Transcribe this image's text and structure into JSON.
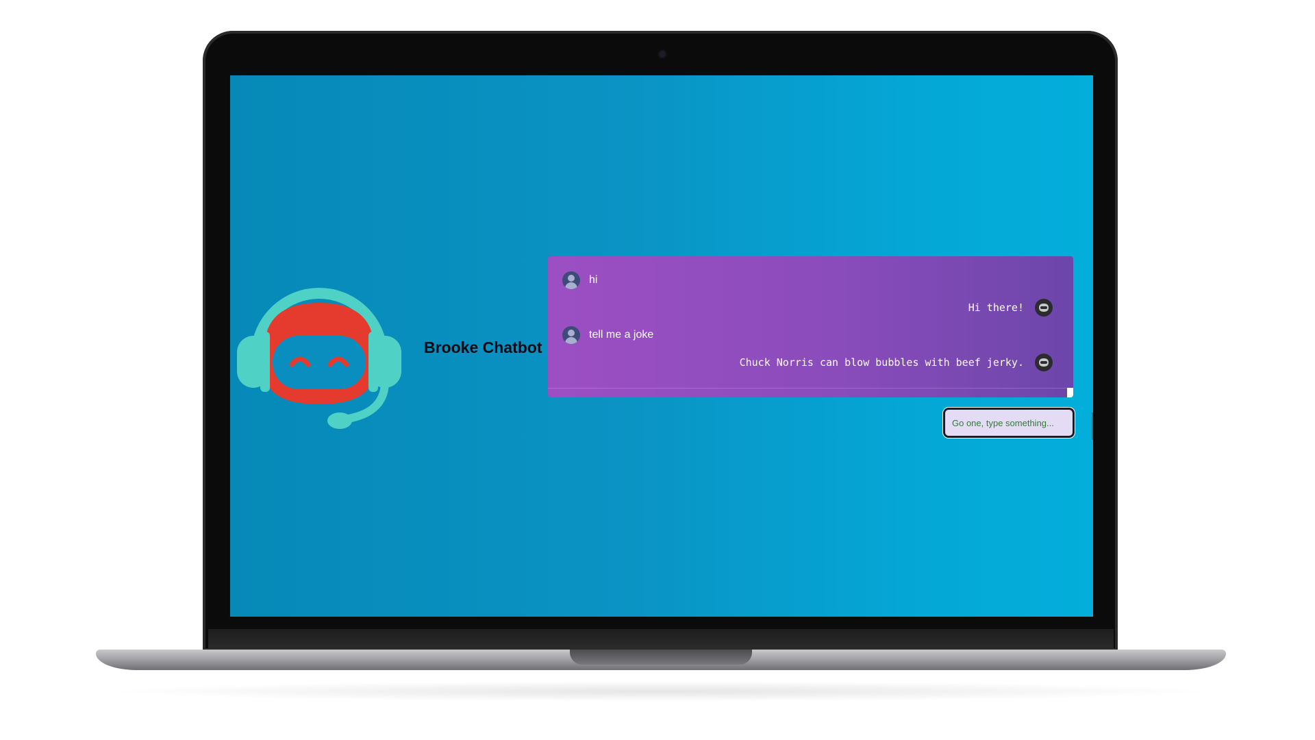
{
  "app": {
    "title": "Brooke Chatbot"
  },
  "chat": {
    "messages": [
      {
        "sender": "user",
        "text": "hi"
      },
      {
        "sender": "bot",
        "text": "Hi there!"
      },
      {
        "sender": "user",
        "text": "tell me a joke"
      },
      {
        "sender": "bot",
        "text": "Chuck Norris can blow bubbles with beef jerky."
      }
    ]
  },
  "input": {
    "placeholder": "Go one, type something..."
  },
  "icons": {
    "bot_logo": "robot-headset-icon",
    "user_avatar": "user-avatar-icon",
    "bot_avatar": "bot-avatar-icon"
  },
  "colors": {
    "screen_bg": "#0a93c4",
    "chat_panel": "#8a4cbb",
    "bot_face": "#e53b2e",
    "headset": "#4fd1c5",
    "input_bg": "#e4dcf5",
    "placeholder": "#2e7d32"
  }
}
